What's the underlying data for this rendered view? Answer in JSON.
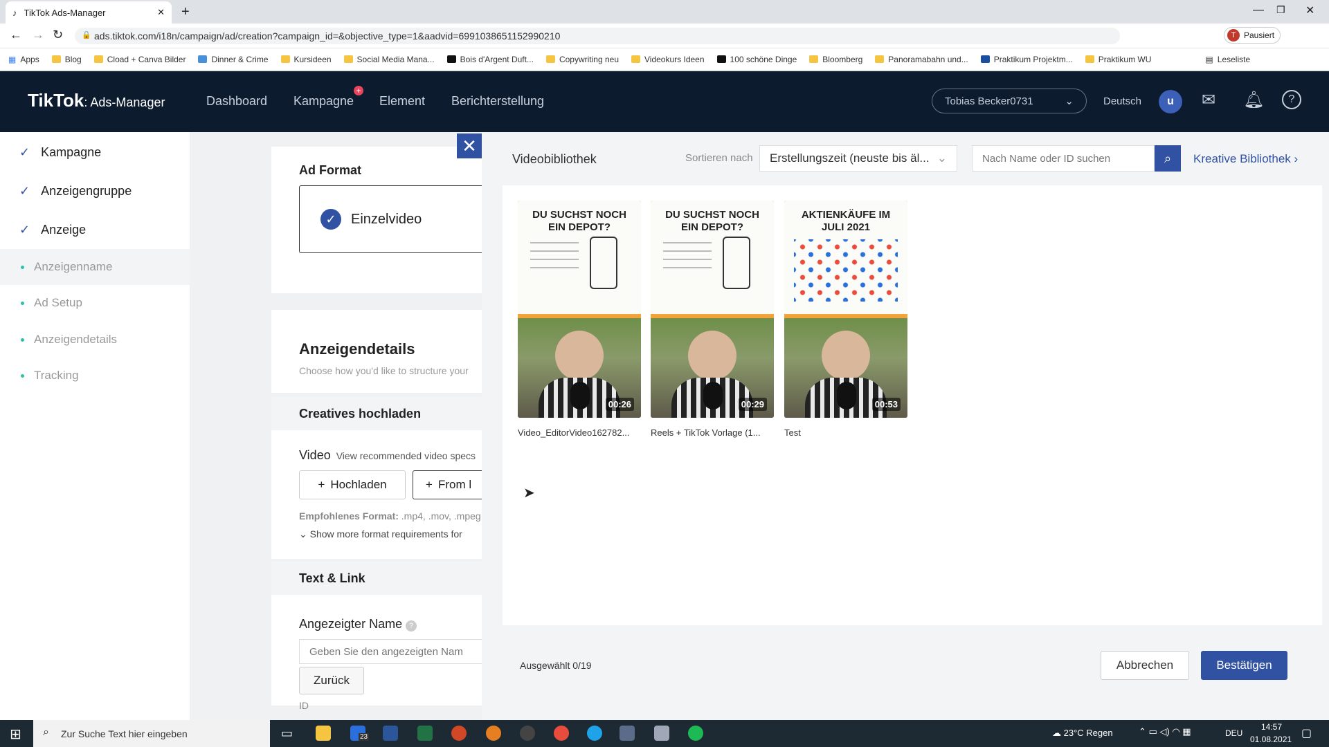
{
  "browser": {
    "tab_title": "TikTok Ads-Manager",
    "url": "ads.tiktok.com/i18n/campaign/ad/creation?campaign_id=&objective_type=1&aadvid=6991038651152990210",
    "profile_status": "Pausiert",
    "bookmarks": [
      "Apps",
      "Blog",
      "Cload + Canva Bilder",
      "Dinner & Crime",
      "Kursideen",
      "Social Media Mana...",
      "Bois d'Argent Duft...",
      "Copywriting neu",
      "Videokurs Ideen",
      "100 schöne Dinge",
      "Bloomberg",
      "Panoramabahn und...",
      "Praktikum Projektm...",
      "Praktikum WU"
    ],
    "reading_list": "Leseliste"
  },
  "header": {
    "logo": "TikTok",
    "logo_sub": "Ads-Manager",
    "nav": [
      "Dashboard",
      "Kampagne",
      "Element",
      "Berichterstellung"
    ],
    "account": "Tobias Becker0731",
    "language": "Deutsch",
    "avatar_letter": "u"
  },
  "sidebar": {
    "steps": [
      "Kampagne",
      "Anzeigengruppe",
      "Anzeige"
    ],
    "substeps": [
      "Anzeigenname",
      "Ad Setup",
      "Anzeigendetails",
      "Tracking"
    ]
  },
  "form": {
    "ad_format_title": "Ad Format",
    "ad_format_option": "Einzelvideo",
    "details_title": "Anzeigendetails",
    "details_desc": "Choose how you'd like to structure your",
    "creatives_title": "Creatives hochladen",
    "video_label": "Video",
    "video_specs": "View recommended video specs",
    "upload_button": "Hochladen",
    "from_button": "From l",
    "format_label": "Empfohlenes Format:",
    "format_values": ".mp4, .mov, .mpeg",
    "more_requirements": "Show more format requirements for",
    "text_link_title": "Text & Link",
    "display_name_label": "Angezeigter Name",
    "display_name_placeholder": "Geben Sie den angezeigten Nam",
    "back_button": "Zurück",
    "partial_label": "ID"
  },
  "drawer": {
    "title": "Videobibliothek",
    "sort_label": "Sortieren nach",
    "sort_value": "Erstellungszeit (neuste bis äl...",
    "search_placeholder": "Nach Name oder ID suchen",
    "creative_library_link": "Kreative Bibliothek",
    "videos": [
      {
        "name": "Video_EditorVideo162782...",
        "duration": "00:26",
        "headline": "DU SUCHST NOCH EIN DEPOT?"
      },
      {
        "name": "Reels + TikTok Vorlage (1...",
        "duration": "00:29",
        "headline": "DU SUCHST NOCH EIN DEPOT?"
      },
      {
        "name": "Test",
        "duration": "00:53",
        "headline": "AKTIENKÄUFE IM JULI 2021"
      }
    ],
    "selected_count": "Ausgewählt 0/19",
    "cancel_button": "Abbrechen",
    "confirm_button": "Bestätigen"
  },
  "taskbar": {
    "search_placeholder": "Zur Suche Text hier eingeben",
    "weather": "23°C  Regen",
    "language": "DEU",
    "time": "14:57",
    "date": "01.08.2021",
    "mail_badge": "23"
  },
  "colors": {
    "header_bg": "#0d1b2e",
    "accent": "#3152a3",
    "success": "#2bc0a8"
  }
}
